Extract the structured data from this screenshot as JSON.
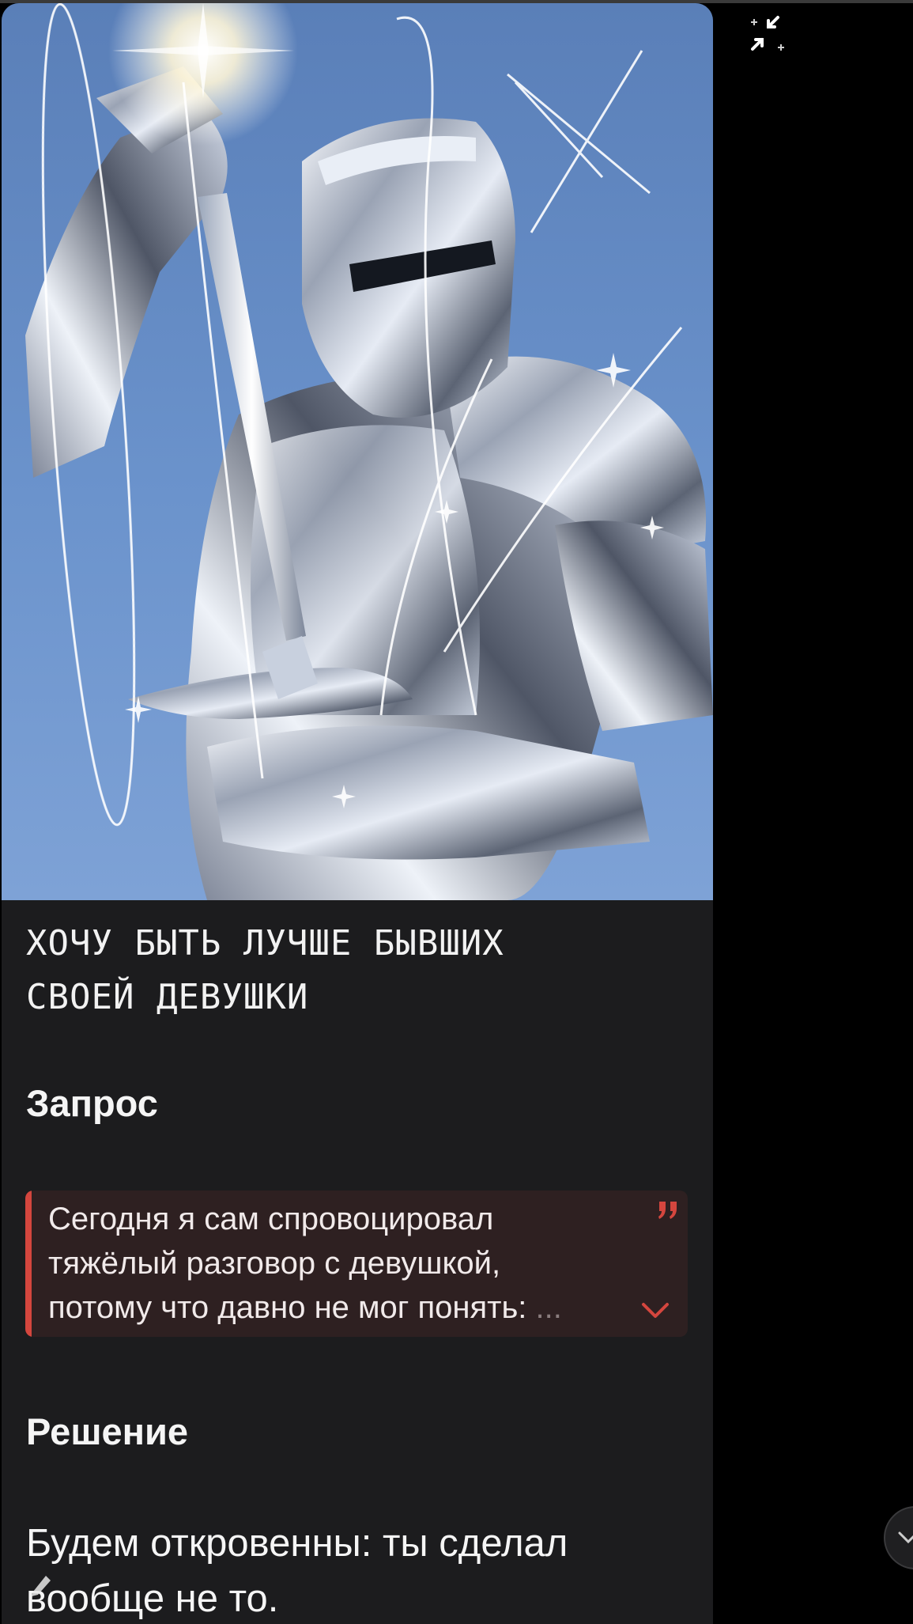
{
  "post": {
    "image_alt": "knight-in-crystal-armor",
    "headline_line1": "ХОЧУ БЫТЬ ЛУЧШЕ БЫВШИХ",
    "headline_line2": "СВОЕЙ ДЕВУШКИ",
    "request_title": "Запрос",
    "quote": {
      "line1": "Сегодня я сам спровоцировал",
      "line2": "тяжёлый разговор с девушкой,",
      "line3": "потому что давно не мог понять:",
      "ellipsis": "..."
    },
    "solution_title": "Решение",
    "answer_line1": "Будем откровенны: ты сделал",
    "answer_line2": "вообще не то."
  },
  "colors": {
    "background": "#000000",
    "card": "#1c1c1e",
    "quote_bg": "#2e2021",
    "quote_accent": "#d4463e",
    "text": "#f5f5f5"
  },
  "icons": {
    "collapse": "collapse-icon",
    "quote": "quote-icon",
    "expand": "chevron-down-icon",
    "scroll": "scroll-down-icon",
    "pen": "pen-icon"
  }
}
